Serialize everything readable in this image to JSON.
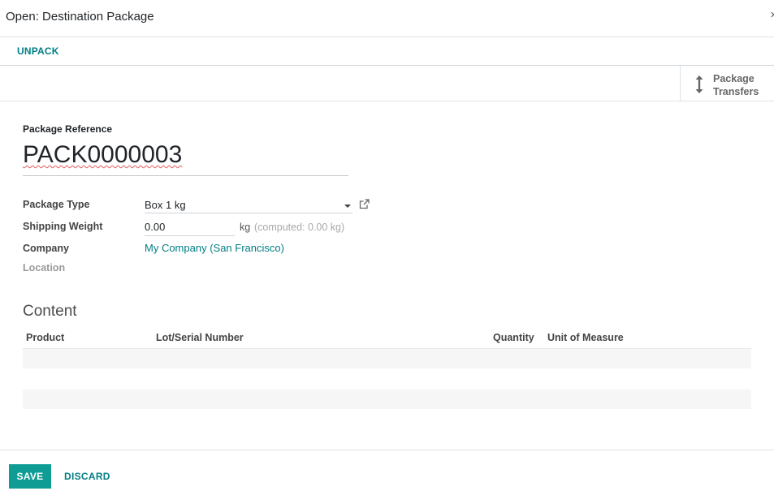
{
  "dialog": {
    "title": "Open: Destination Package",
    "close_glyph": "×"
  },
  "statusbar": {
    "unpack_label": "UNPACK"
  },
  "smart_button": {
    "label_line1": "Package",
    "label_line2": "Transfers",
    "icon": "arrows-v-icon"
  },
  "form": {
    "reference_label": "Package Reference",
    "reference_value": "PACK0000003",
    "package_type_label": "Package Type",
    "package_type_value": "Box 1 kg",
    "shipping_weight_label": "Shipping Weight",
    "shipping_weight_value": "0.00",
    "shipping_weight_unit": "kg",
    "shipping_weight_computed": "(computed: 0.00 kg)",
    "company_label": "Company",
    "company_value": "My Company (San Francisco)",
    "location_label": "Location"
  },
  "content": {
    "title": "Content",
    "columns": [
      "Product",
      "Lot/Serial Number",
      "Quantity",
      "Unit of Measure"
    ]
  },
  "footer": {
    "save_label": "SAVE",
    "discard_label": "DISCARD"
  },
  "colors": {
    "accent": "#017e84",
    "primary_button": "#0f9c95"
  }
}
